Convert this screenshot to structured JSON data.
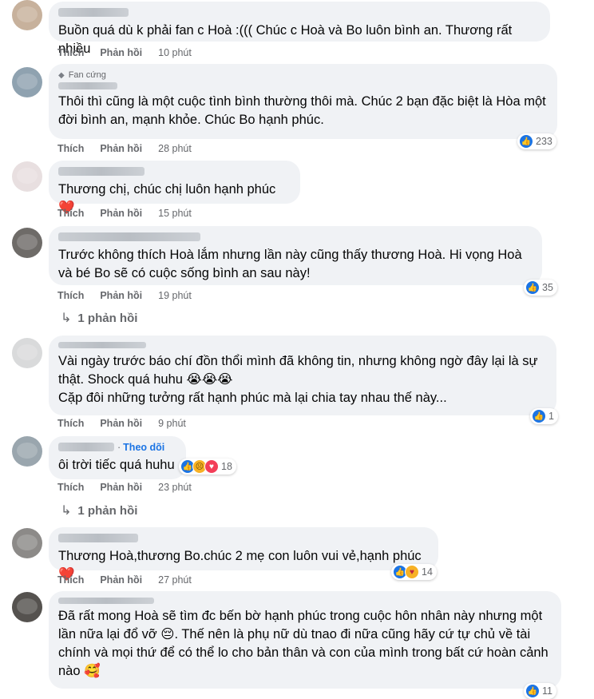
{
  "labels": {
    "like": "Thích",
    "reply": "Phản hồi"
  },
  "comments": [
    {
      "text": "Buồn quá dù k phải fan c Hoà :((( Chúc c Hoà và Bo luôn bình an. Thương rất nhiều",
      "time": "10 phút"
    },
    {
      "badge": "Fan cứng",
      "text": "Thôi thì cũng là một cuộc tình bình thường thôi mà. Chúc 2 bạn đặc biệt là Hòa một đời bình an, mạnh khỏe. Chúc Bo hạnh phúc.",
      "time": "28 phút",
      "reactions": {
        "types": [
          "like"
        ],
        "count": "233"
      }
    },
    {
      "text": "Thương chị, chúc chị luôn hạnh phúc ❤️",
      "time": "15 phút"
    },
    {
      "text": "Trước không thích Hoà lắm nhưng lần này cũng thấy thương Hoà. Hi vọng Hoà và bé Bo sẽ có cuộc sống bình an sau này!",
      "time": "19 phút",
      "reactions": {
        "types": [
          "like"
        ],
        "count": "35"
      },
      "replies": "1 phản hồi"
    },
    {
      "text": "Vài ngày trước báo chí đồn thổi mình đã không tin, nhưng không ngờ đây lại là sự thật. Shock quá huhu 😭😭😭\nCặp đôi những tưởng rất hạnh phúc mà lại chia tay nhau thế này...",
      "time": "9 phút",
      "reactions": {
        "types": [
          "like"
        ],
        "count": "1"
      }
    },
    {
      "follow": "Theo dõi",
      "text": "ôi trời tiếc quá huhu",
      "time": "23 phút",
      "reactions": {
        "types": [
          "like",
          "sad",
          "love"
        ],
        "count": "18"
      },
      "replies": "1 phản hồi"
    },
    {
      "text": "Thương Hoà,thương Bo.chúc 2 mẹ con luôn vui vẻ,hạnh phúc❤️",
      "time": "27 phút",
      "reactions": {
        "types": [
          "like",
          "care"
        ],
        "count": "14"
      }
    },
    {
      "text": "Đã rất mong Hoà sẽ tìm đc bến bờ hạnh phúc trong cuộc hôn nhân này nhưng một lần nữa lại đổ vỡ 😔. Thế nên là phụ nữ dù tnao đi nữa cũng hãy cứ tự chủ về tài chính và mọi thứ để có thể lo cho bản thân và con của mình trong bất cứ hoàn cảnh nào 🥰",
      "reactions": {
        "types": [
          "like"
        ],
        "count": "11"
      }
    }
  ],
  "colors": {
    "bubble": "#f0f2f5",
    "meta": "#65676b",
    "link": "#1b74e4",
    "like": "#1b74e4",
    "love": "#f33e58"
  }
}
